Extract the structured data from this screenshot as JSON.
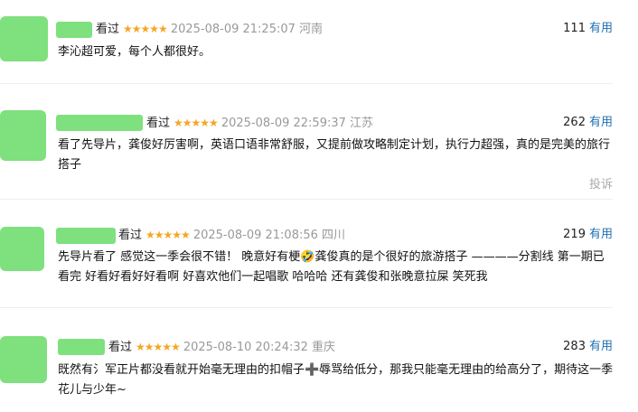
{
  "comments": [
    {
      "watched": "看过",
      "stars": "★★★★★",
      "time": "2025-08-09 21:25:07",
      "location": "河南",
      "votes": "111",
      "useful": "有用",
      "content": "李沁超可爱，每个人都很好。"
    },
    {
      "watched": "看过",
      "stars": "★★★★★",
      "time": "2025-08-09 22:59:37",
      "location": "江苏",
      "votes": "262",
      "useful": "有用",
      "content": "看了先导片，龚俊好厉害啊，英语口语非常舒服，又提前做攻略制定计划，执行力超强，真的是完美的旅行搭子",
      "report": "投诉"
    },
    {
      "watched": "看过",
      "stars": "★★★★★",
      "time": "2025-08-09 21:08:56",
      "location": "四川",
      "votes": "219",
      "useful": "有用",
      "content": "先导片看了 感觉这一季会很不错！ 晚意好有梗🤣龚俊真的是个很好的旅游搭子 ————分割线 第一期已看完 好看好看好好看啊 好喜欢他们一起唱歌 哈哈哈 还有龚俊和张晚意拉屎 笑死我"
    },
    {
      "watched": "看过",
      "stars": "★★★★★",
      "time": "2025-08-10 20:24:32",
      "location": "重庆",
      "votes": "283",
      "useful": "有用",
      "content": "既然有氵军正片都没看就开始毫无理由的扣帽子➕辱骂给低分，那我只能毫无理由的给高分了，期待这一季花儿与少年~"
    }
  ],
  "colors": {
    "avatar": "#7fe07e",
    "stars": "#f5a623",
    "useful": "#1f6fb2",
    "meta": "#999999"
  }
}
